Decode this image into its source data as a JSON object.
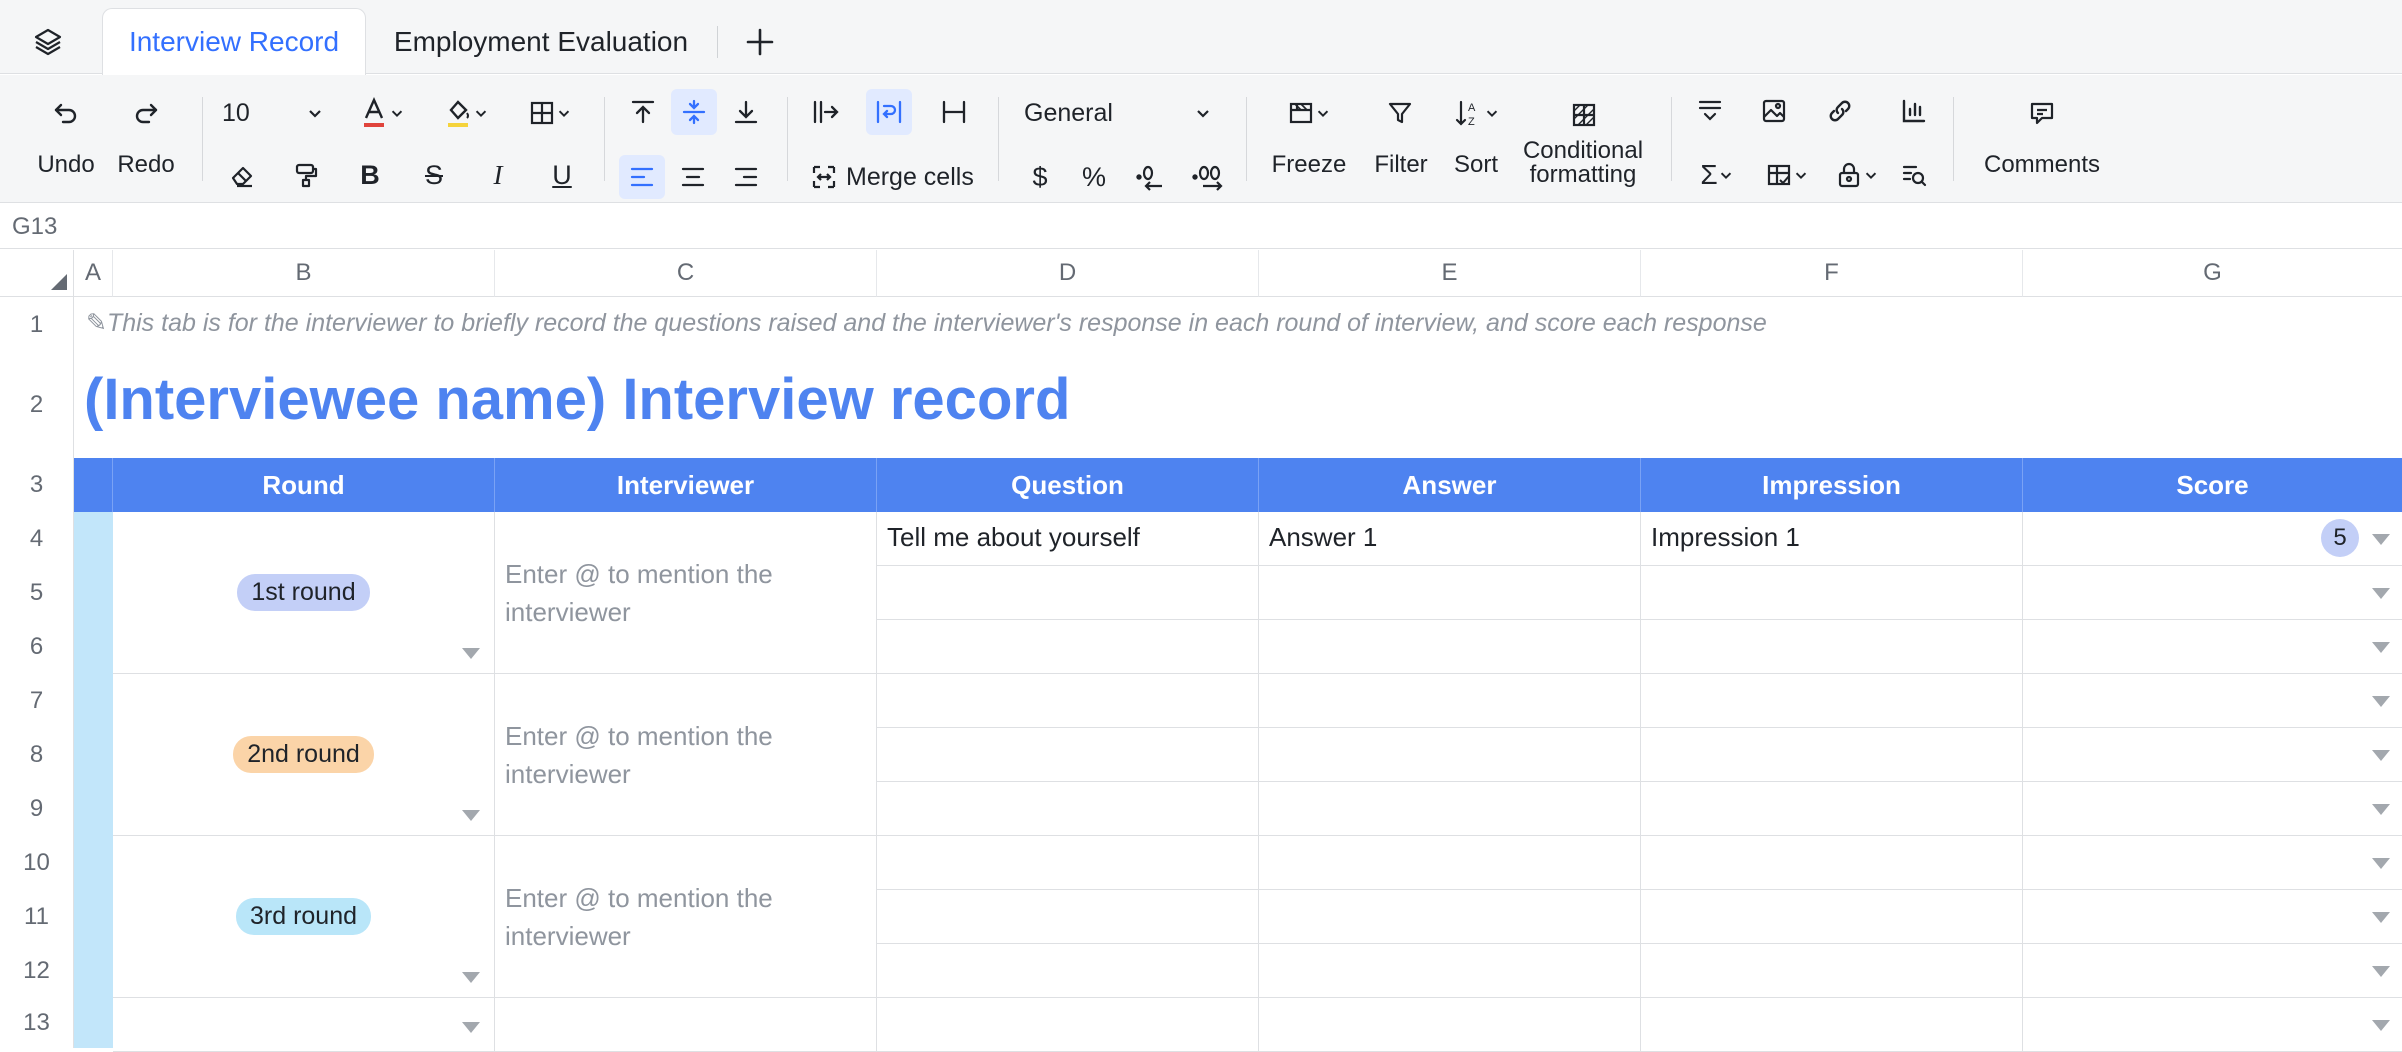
{
  "tabs": [
    {
      "label": "Interview Record",
      "active": true
    },
    {
      "label": "Employment Evaluation",
      "active": false
    }
  ],
  "toolbar": {
    "undo": "Undo",
    "redo": "Redo",
    "font_size": "10",
    "merge_cells": "Merge cells",
    "number_format": "General",
    "currency": "$",
    "percent": "%",
    "freeze": "Freeze",
    "filter": "Filter",
    "sort": "Sort",
    "conditional_line1": "Conditional",
    "conditional_line2": "formatting",
    "comments": "Comments",
    "font_color": "#e0443c",
    "fill_color": "#f5d33b"
  },
  "namebar": {
    "cell_ref": "G13"
  },
  "columns": [
    "A",
    "B",
    "C",
    "D",
    "E",
    "F",
    "G"
  ],
  "rows": [
    "1",
    "2",
    "3",
    "4",
    "5",
    "6",
    "7",
    "8",
    "9",
    "10",
    "11",
    "12",
    "13"
  ],
  "sheet": {
    "note": "✎This tab is for the interviewer to briefly record the questions raised and the interviewer's response in each round of interview, and score each response",
    "title": "(Interviewee name) Interview record",
    "headers": [
      "Round",
      "Interviewer",
      "Question",
      "Answer",
      "Impression",
      "Score"
    ],
    "rounds": [
      {
        "label": "1st round",
        "color": "#c3cff7",
        "interviewer_placeholder": "Enter @ to mention the interviewer"
      },
      {
        "label": "2nd round",
        "color": "#fbd4a8",
        "interviewer_placeholder": "Enter @ to mention the interviewer"
      },
      {
        "label": "3rd round",
        "color": "#b9e6f9",
        "interviewer_placeholder": "Enter @ to mention the interviewer"
      }
    ],
    "row4": {
      "question": "Tell me about yourself",
      "answer": "Answer 1",
      "impression": "Impression 1",
      "score": "5"
    },
    "header_color": "#4e83f0",
    "title_color": "#4e83f0"
  }
}
